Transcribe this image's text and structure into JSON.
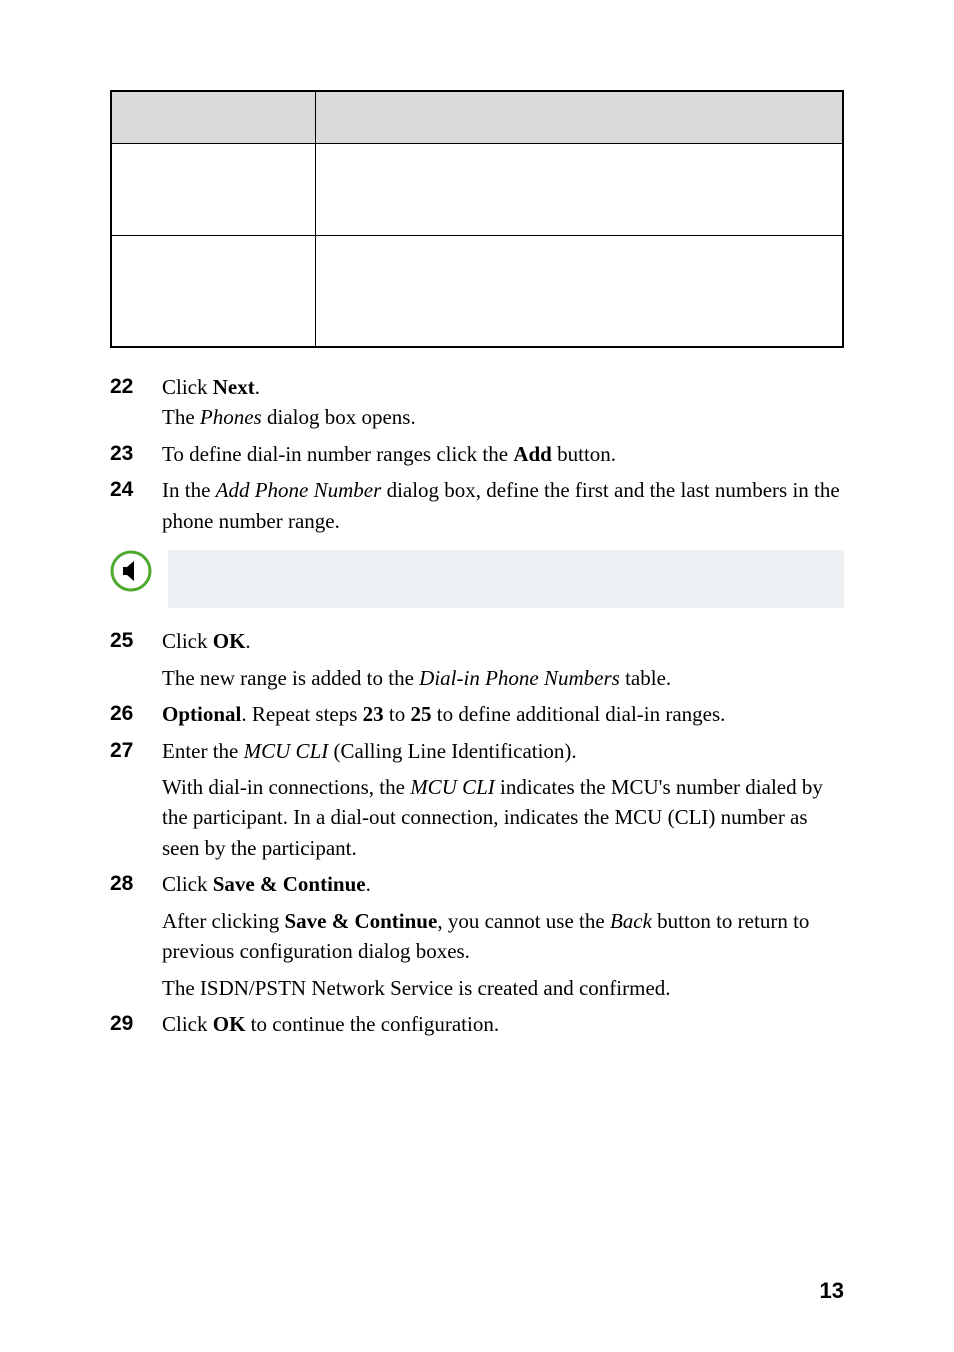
{
  "table": {
    "headers": {
      "field": "",
      "description": ""
    },
    "rows": [
      {
        "field": "",
        "description": ""
      },
      {
        "field": "",
        "description": ""
      }
    ]
  },
  "steps": {
    "s22": {
      "num": "22",
      "pre": "Click ",
      "bold": "Next",
      "post": ".",
      "sub_a": "The ",
      "sub_it": "Phones",
      "sub_b": " dialog box opens."
    },
    "s23": {
      "num": "23",
      "a": "To define dial-in number ranges click the ",
      "bold": "Add",
      "b": " button."
    },
    "s24": {
      "num": "24",
      "a": "In the ",
      "it": "Add Phone Number",
      "b": " dialog box, define the first and the last numbers in the phone number range."
    },
    "s25": {
      "num": "25",
      "a": "Click ",
      "bold": "OK",
      "b": ".",
      "sub_a": "The new range is added to the ",
      "sub_it": "Dial-in Phone Numbers",
      "sub_b": " table."
    },
    "s26": {
      "num": "26",
      "bold1": "Optional",
      "a": ". Repeat steps ",
      "bold2": "23",
      "b": " to ",
      "bold3": "25",
      "c": " to define additional dial-in ranges."
    },
    "s27": {
      "num": "27",
      "a": "Enter the ",
      "it": "MCU CLI",
      "b": " (Calling Line Identification).",
      "sub_a": "With dial-in connections, the ",
      "sub_it": "MCU CLI",
      "sub_b": " indicates the MCU's number dialed by the participant. In a dial-out connection, indicates the MCU (CLI) number as seen by the participant."
    },
    "s28": {
      "num": "28",
      "a": "Click ",
      "bold1": "Save & Continue",
      "b": ".",
      "sub1_a": "After clicking ",
      "sub1_bold": "Save & Continue",
      "sub1_b": ", you cannot use the ",
      "sub1_it": "Back",
      "sub1_c": " button to return to previous configuration dialog boxes.",
      "sub2": "The ISDN/PSTN Network Service is created and confirmed."
    },
    "s29": {
      "num": "29",
      "a": "Click ",
      "bold": "OK",
      "b": " to continue the configuration."
    }
  },
  "note_icon": "speaker-icon",
  "page_number": "13"
}
